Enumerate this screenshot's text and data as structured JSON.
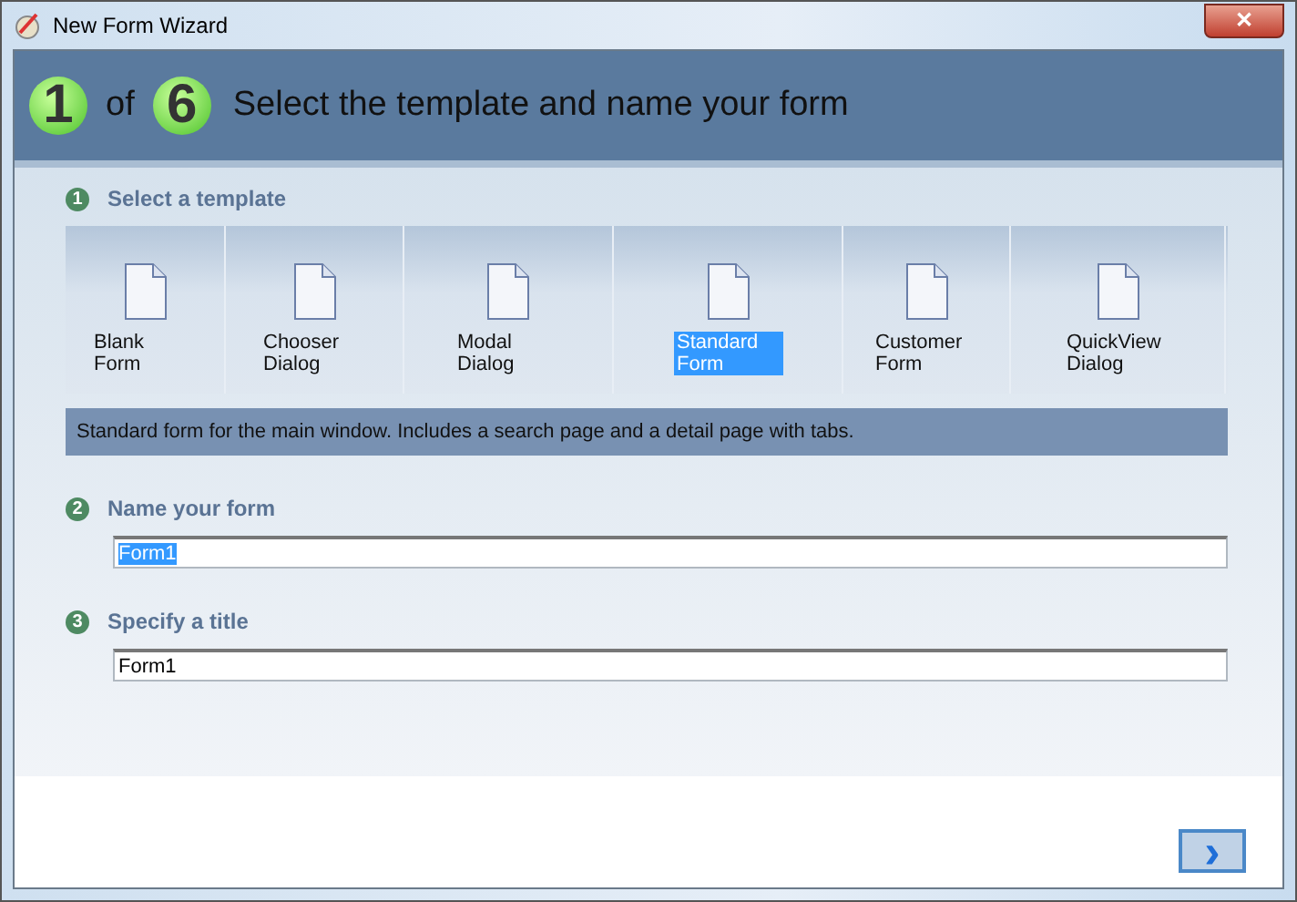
{
  "window": {
    "title": "New Form Wizard",
    "close": "✕"
  },
  "header": {
    "step": "1",
    "of": "of",
    "total": "6",
    "title": "Select the template and name your form"
  },
  "sections": [
    {
      "number": "1",
      "label": "Select a template",
      "kind": "templates"
    },
    {
      "number": "2",
      "label": "Name your form",
      "kind": "field",
      "value": "Form1",
      "text_selected": true
    },
    {
      "number": "3",
      "label": "Specify a title",
      "kind": "field",
      "value": "Form1",
      "text_selected": false
    }
  ],
  "templates": [
    {
      "label": "Blank\nForm",
      "selected": false
    },
    {
      "label": "Chooser\nDialog",
      "selected": false
    },
    {
      "label": "Modal\nDialog",
      "selected": false
    },
    {
      "label": "Standard\nForm",
      "selected": true
    },
    {
      "label": "Customer\nForm",
      "selected": false
    },
    {
      "label": "QuickView\nDialog",
      "selected": false
    }
  ],
  "description": "Standard form for the main window.  Includes a search page and a detail page with tabs.",
  "next_button": "›"
}
